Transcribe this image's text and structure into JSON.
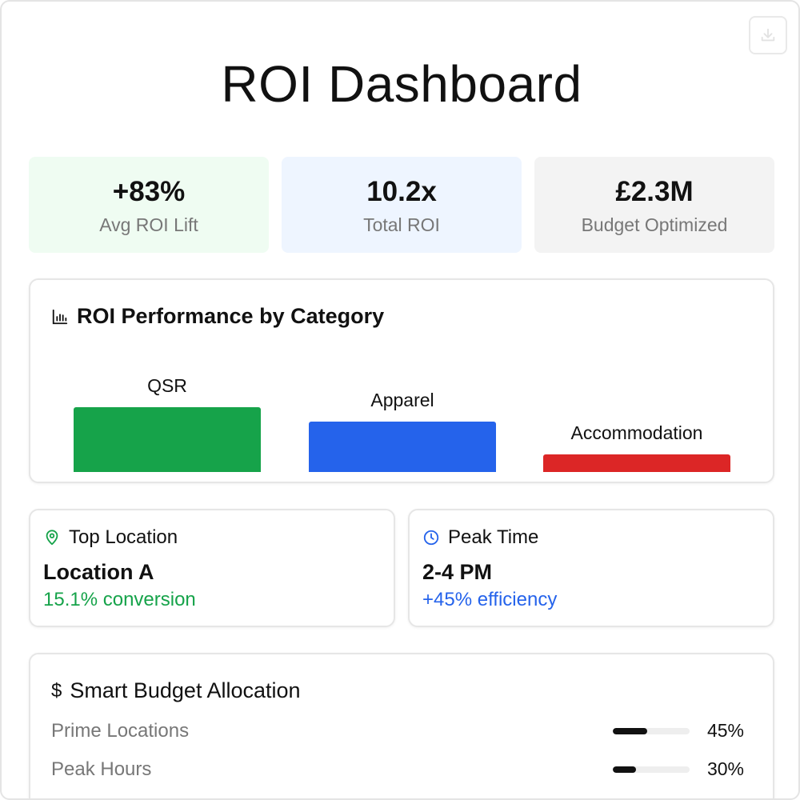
{
  "header": {
    "title": "ROI Dashboard",
    "download_icon": "download-icon"
  },
  "kpis": [
    {
      "value": "+83%",
      "label": "Avg ROI Lift",
      "bg": "#effcf2"
    },
    {
      "value": "10.2x",
      "label": "Total ROI",
      "bg": "#eef5ff"
    },
    {
      "value": "£2.3M",
      "label": "Budget Optimized",
      "bg": "#f3f3f3"
    }
  ],
  "chart_section": {
    "title": "ROI Performance by Category",
    "icon": "bar-chart-icon"
  },
  "chart_data": {
    "type": "bar",
    "categories": [
      "QSR",
      "Apparel",
      "Accommodation"
    ],
    "values": [
      81,
      63,
      22
    ],
    "colors": [
      "#16a34a",
      "#2563eb",
      "#dc2626"
    ],
    "ylim": [
      0,
      100
    ],
    "grid": false
  },
  "top_location": {
    "title": "Top Location",
    "icon": "map-pin-icon",
    "value": "Location A",
    "sub": "15.1% conversion",
    "accent": "#16a34a"
  },
  "peak_time": {
    "title": "Peak Time",
    "icon": "clock-icon",
    "value": "2-4 PM",
    "sub": "+45% efficiency",
    "accent": "#2563eb"
  },
  "budget": {
    "title": "Smart Budget Allocation",
    "icon": "dollar-icon",
    "rows": [
      {
        "label": "Prime Locations",
        "percent": "45%",
        "fill": 0.45
      },
      {
        "label": "Peak Hours",
        "percent": "30%",
        "fill": 0.3
      }
    ]
  }
}
